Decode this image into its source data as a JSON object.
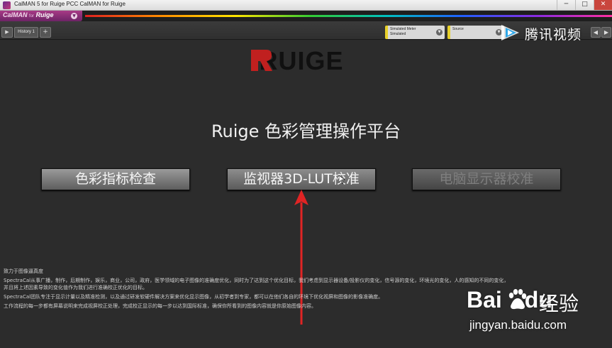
{
  "window": {
    "title": "CalMAN 5 for Ruige PCC CalMAN for Ruige",
    "minimize": "─",
    "maximize": "□",
    "close": "✕"
  },
  "menu": {
    "calman_label": "CalMAN",
    "calman_for": "for",
    "calman_brand": "Ruige",
    "dropdown_icon": "▼"
  },
  "toolbar": {
    "play_icon": "▶",
    "history_tab": "History 1",
    "add_tab": "+",
    "meter": {
      "line1": "Simulated Meter",
      "line2": "Simulated"
    },
    "source": {
      "line1": "Source"
    },
    "arrow_icon": "▼",
    "prev_icon": "◀",
    "next_icon": "▶"
  },
  "main": {
    "logo_text": "RUIGE",
    "title": "Ruige 色彩管理操作平台",
    "buttons": [
      {
        "label": "色彩指标检查",
        "enabled": true
      },
      {
        "label": "监视器3D-LUT校准",
        "enabled": true
      },
      {
        "label": "电脑显示器校准",
        "enabled": false
      }
    ],
    "description": [
      "致力于图像逼真度",
      "SpectraCal从事广播，制作，后期制作，娱乐，商业，公司，政府，医学领域的电子图像的准确度优化，同时为了达到这个优化目标，我们考虑到显示器设备/投影仪的变化，信号源的变化，环境光的变化，人的感知的不同的变化，",
      "并且将上述因素导致的变化值作为我们进行准确校正优化的目标。",
      "SpectraCal团队专注于显示计量以及精准检测，以及通过研发软硬件解决方案来优化显示图像，从初学者到专家，都可以在他们各自的环境下优化视屏和图像的影像准确度。",
      "工作流程的每一步都有屏幕说明来完成视屏校正处理，完成校正显示的每一步以达到国际标准，确保你所看到的图像内容就是你原始图像内容。"
    ]
  },
  "watermarks": {
    "tencent": "腾讯视频",
    "baidu_brand": "Bai",
    "baidu_brand_tail": "du",
    "baidu_jingyan": "经验",
    "baidu_url": "jingyan.baidu.com"
  },
  "colors": {
    "accent_purple": "#a83a86",
    "meter_yellow": "#e7d02a",
    "logo_red": "#c0201f",
    "annotation_red": "#e02424"
  }
}
